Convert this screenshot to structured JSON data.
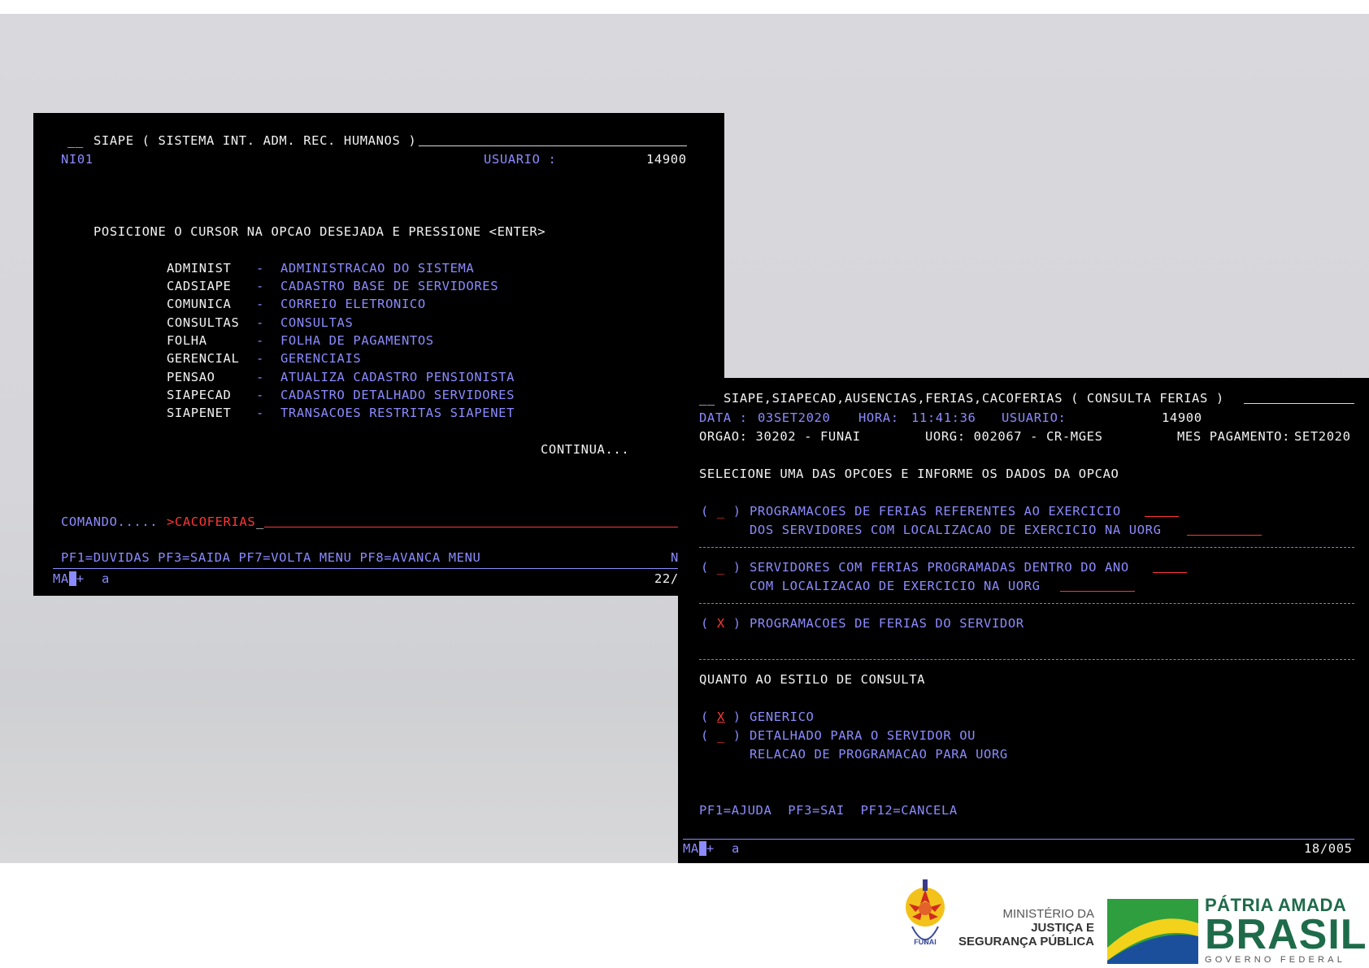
{
  "menu_screen": {
    "title": "SIAPE ( SISTEMA INT. ADM. REC. HUMANOS )",
    "screen_id": "NI01",
    "user_label": "USUARIO :",
    "user_value": "14900",
    "instruction": "POSICIONE O CURSOR NA OPCAO DESEJADA E PRESSIONE <ENTER>",
    "options": [
      {
        "code": "ADMINIST",
        "desc": "ADMINISTRACAO DO SISTEMA"
      },
      {
        "code": "CADSIAPE",
        "desc": "CADASTRO BASE DE SERVIDORES"
      },
      {
        "code": "COMUNICA",
        "desc": "CORREIO ELETRONICO"
      },
      {
        "code": "CONSULTAS",
        "desc": "CONSULTAS"
      },
      {
        "code": "FOLHA",
        "desc": "FOLHA DE PAGAMENTOS"
      },
      {
        "code": "GERENCIAL",
        "desc": "GERENCIAIS"
      },
      {
        "code": "PENSAO",
        "desc": "ATUALIZA CADASTRO PENSIONISTA"
      },
      {
        "code": "SIAPECAD",
        "desc": "CADASTRO DETALHADO SERVIDORES"
      },
      {
        "code": "SIAPENET",
        "desc": "TRANSACOES RESTRITAS SIAPENET"
      }
    ],
    "continua": "CONTINUA...",
    "command_label": "COMANDO.....",
    "command_value": ">CACOFERIAS",
    "pf_keys": "PF1=DUVIDAS PF3=SAIDA PF7=VOLTA MENU PF8=AVANCA MENU",
    "pf_trail": "N",
    "status_mode": "MA",
    "status_plus": "+",
    "status_a": "a",
    "status_pos": "22/"
  },
  "ferias_screen": {
    "title": "SIAPE,SIAPECAD,AUSENCIAS,FERIAS,CACOFERIAS ( CONSULTA FERIAS )",
    "data_label": "DATA :",
    "data_value": "03SET2020",
    "hora_label": "HORA:",
    "hora_value": "11:41:36",
    "user_label": "USUARIO:",
    "user_value": "14900",
    "orgao": "ORGAO: 30202 - FUNAI",
    "uorg": "UORG: 002067 - CR-MGES",
    "mes_label": "MES PAGAMENTO:",
    "mes_value": "SET2020",
    "instruction": "SELECIONE UMA DAS OPCOES E INFORME OS DADOS DA OPCAO",
    "opt1_mark": "_",
    "opt1_line1": "PROGRAMACOES DE FERIAS REFERENTES AO EXERCICIO",
    "opt1_line2": "DOS SERVIDORES COM LOCALIZACAO DE EXERCICIO NA UORG",
    "opt2_mark": "_",
    "opt2_line1": "SERVIDORES COM FERIAS PROGRAMADAS DENTRO DO ANO",
    "opt2_line2": "COM LOCALIZACAO DE EXERCICIO NA UORG",
    "opt3_mark": "X",
    "opt3_line1": "PROGRAMACOES DE FERIAS DO SERVIDOR",
    "style_heading": "QUANTO AO ESTILO DE CONSULTA",
    "style1_mark": "X",
    "style1_label": "GENERICO",
    "style2_mark": "_",
    "style2_line1": "DETALHADO PARA O SERVIDOR OU",
    "style2_line2": "RELACAO DE PROGRAMACAO PARA UORG",
    "pf_keys": "PF1=AJUDA  PF3=SAI  PF12=CANCELA",
    "status_mode": "MA",
    "status_plus": "+",
    "status_a": "a",
    "status_pos": "18/005"
  },
  "footer": {
    "ministry_line1": "MINISTÉRIO DA",
    "ministry_line2": "JUSTIÇA E",
    "ministry_line3": "SEGURANÇA PÚBLICA",
    "patria_line1": "PÁTRIA AMADA",
    "patria_line2": "BRASIL",
    "patria_line3": "GOVERNO FEDERAL",
    "funai_emblem": "FUNAI",
    "colors": {
      "green": "#2e9e3e",
      "yellow": "#f2d21b",
      "blue": "#1b4f9c",
      "navy": "#1e3a6e"
    }
  }
}
